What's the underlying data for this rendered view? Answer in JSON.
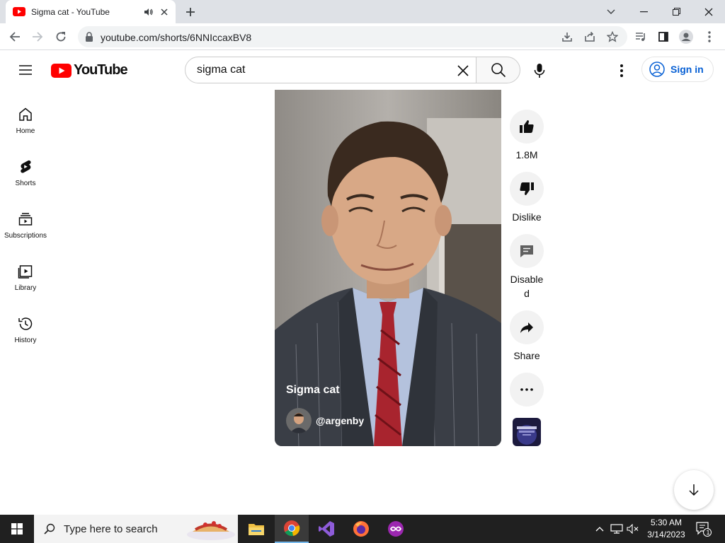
{
  "browser": {
    "tab_title": "Sigma cat - YouTube",
    "url": "youtube.com/shorts/6NNIccaxBV8"
  },
  "masthead": {
    "logo_text": "YouTube",
    "search_value": "sigma cat",
    "search_placeholder": "Search",
    "sign_in_label": "Sign in"
  },
  "guide": {
    "items": [
      {
        "label": "Home",
        "icon": "home-icon"
      },
      {
        "label": "Shorts",
        "icon": "shorts-icon"
      },
      {
        "label": "Subscriptions",
        "icon": "subscriptions-icon"
      },
      {
        "label": "Library",
        "icon": "library-icon"
      },
      {
        "label": "History",
        "icon": "history-icon"
      }
    ]
  },
  "video": {
    "title": "Sigma cat",
    "channel": "@argenby"
  },
  "actions": {
    "like_count": "1.8M",
    "dislike_label": "Dislike",
    "comments_label": "Disabled",
    "share_label": "Share"
  },
  "taskbar": {
    "search_placeholder": "Type here to search",
    "time": "5:30 AM",
    "date": "3/14/2023",
    "notification_count": "1"
  },
  "colors": {
    "youtube_red": "#ff0000",
    "signin_blue": "#065fd4",
    "taskbar_bg": "#202020"
  }
}
